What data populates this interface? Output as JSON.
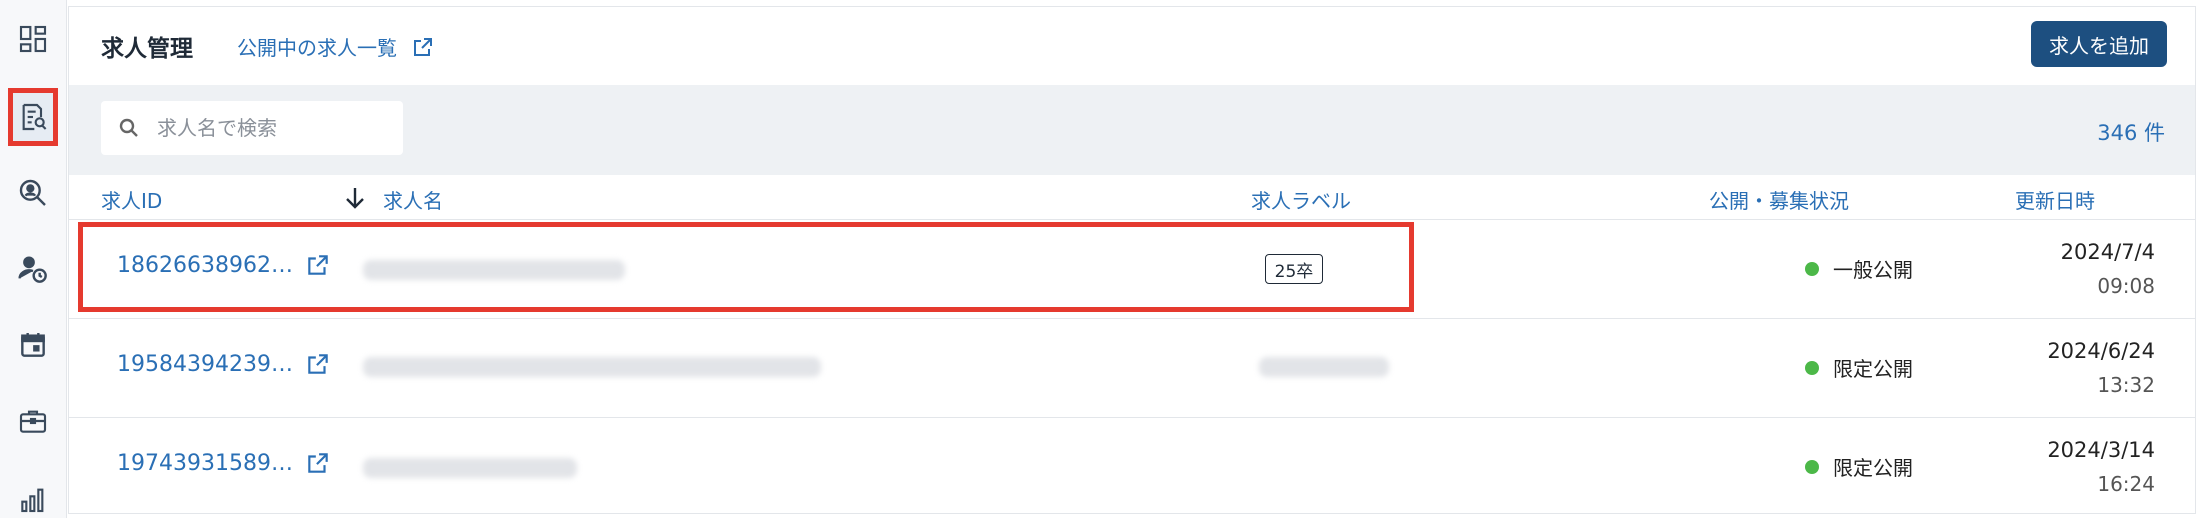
{
  "header": {
    "title": "求人管理",
    "public_link_label": "公開中の求人一覧",
    "add_button_label": "求人を追加"
  },
  "search": {
    "placeholder": "求人名で検索",
    "value": ""
  },
  "count_label": "346 件",
  "columns": {
    "id": "求人ID",
    "name": "求人名",
    "label": "求人ラベル",
    "status": "公開・募集状況",
    "updated": "更新日時"
  },
  "rows": [
    {
      "id": "18626638962…",
      "label": "25卒",
      "status": "一般公開",
      "date": "2024/7/4",
      "time": "09:08"
    },
    {
      "id": "19584394239…",
      "label": "",
      "status": "限定公開",
      "date": "2024/6/24",
      "time": "13:32"
    },
    {
      "id": "19743931589…",
      "label": "",
      "status": "限定公開",
      "date": "2024/3/14",
      "time": "16:24"
    }
  ],
  "sidebar": {
    "items": [
      {
        "icon": "dashboard-icon"
      },
      {
        "icon": "job-search-icon",
        "active": true
      },
      {
        "icon": "person-search-icon"
      },
      {
        "icon": "person-clock-icon"
      },
      {
        "icon": "calendar-icon"
      },
      {
        "icon": "briefcase-icon"
      },
      {
        "icon": "bar-chart-icon"
      }
    ]
  },
  "colors": {
    "accent": "#2a6fb5",
    "button": "#1d4f80",
    "status_green": "#4cb848",
    "highlight": "#e53a2f"
  }
}
